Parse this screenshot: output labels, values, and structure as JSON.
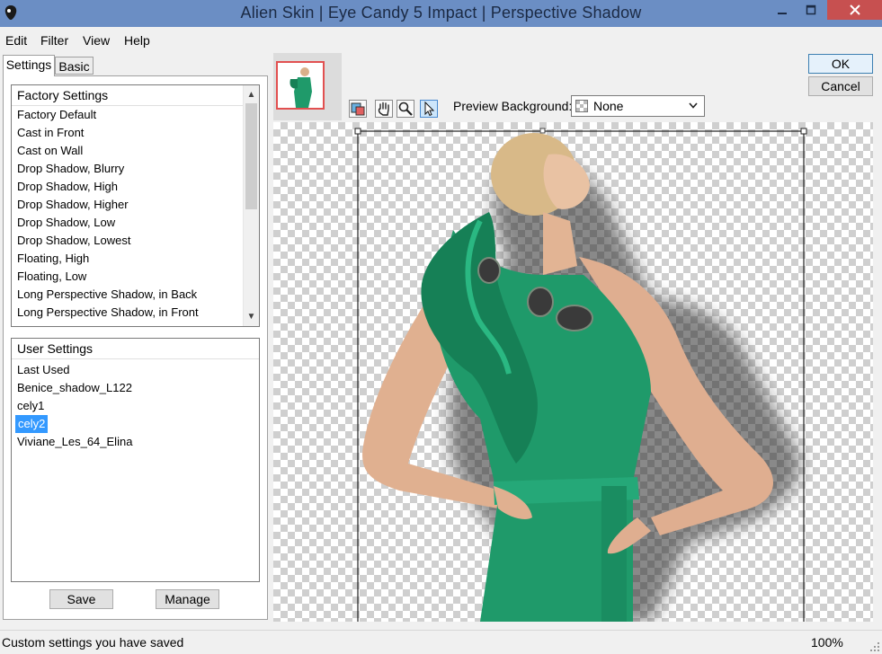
{
  "window": {
    "title": "Alien Skin | Eye Candy 5 Impact | Perspective Shadow"
  },
  "menu": [
    "Edit",
    "Filter",
    "View",
    "Help"
  ],
  "tabs": {
    "settings": "Settings",
    "basic": "Basic"
  },
  "factory": {
    "header": "Factory Settings",
    "items": [
      "Factory Default",
      "Cast in Front",
      "Cast on Wall",
      "Drop Shadow, Blurry",
      "Drop Shadow, High",
      "Drop Shadow, Higher",
      "Drop Shadow, Low",
      "Drop Shadow, Lowest",
      "Floating, High",
      "Floating, Low",
      "Long Perspective Shadow, in Back",
      "Long Perspective Shadow, in Front"
    ]
  },
  "user": {
    "header": "User Settings",
    "items": [
      "Last Used",
      "Benice_shadow_L122",
      "cely1",
      "cely2",
      "Viviane_Les_64_Elina"
    ],
    "selected": "cely2"
  },
  "buttons": {
    "save": "Save",
    "manage": "Manage",
    "ok": "OK",
    "cancel": "Cancel"
  },
  "preview": {
    "label": "Preview Background:",
    "value": "None"
  },
  "status": {
    "text": "Custom settings you have saved",
    "zoom": "100%"
  },
  "colors": {
    "titlebar": "#6b8ec4",
    "close": "#c75050",
    "selection": "#3399ff",
    "dress": "#1f9a6a"
  },
  "icons": [
    "eye-candy-logo-icon",
    "minimize-icon",
    "maximize-icon",
    "close-icon",
    "navigator-icon",
    "hand-tool-icon",
    "zoom-tool-icon",
    "pointer-tool-icon",
    "dropdown-arrow-icon",
    "resize-grip-icon"
  ]
}
